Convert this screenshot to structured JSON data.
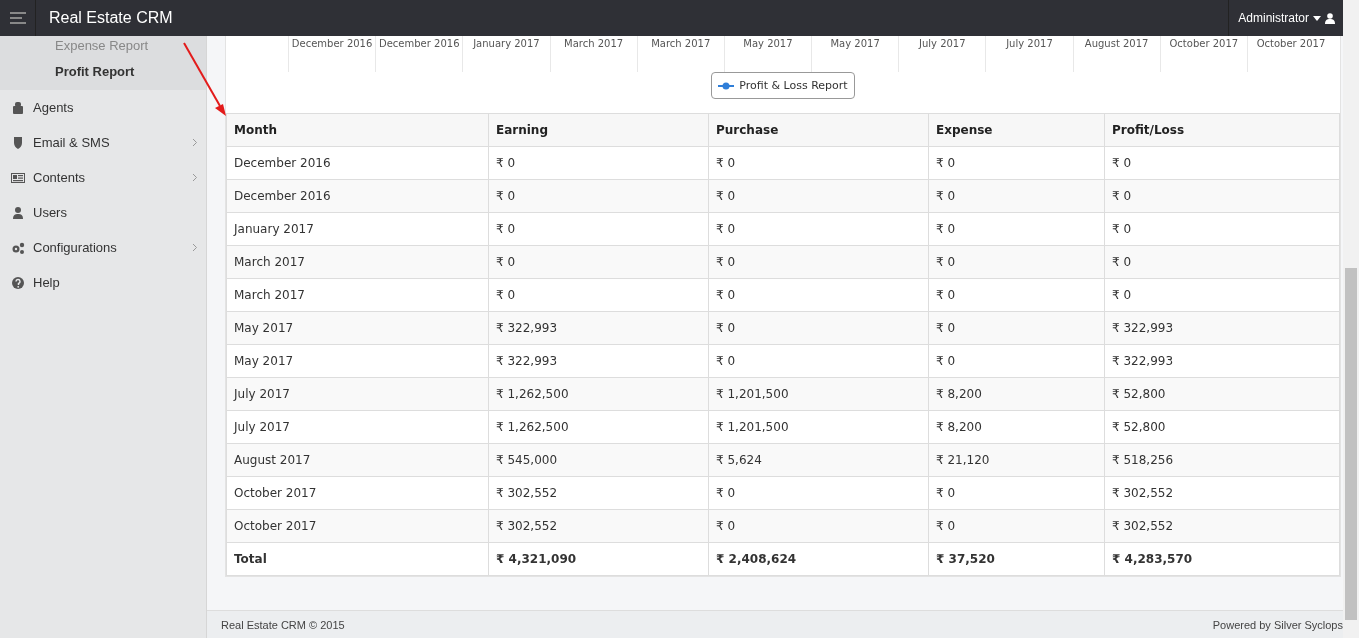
{
  "app": {
    "title": "Real Estate CRM",
    "user": "Administrator"
  },
  "sidebar": {
    "subitems": [
      {
        "label": "Expense Report",
        "selected": false
      },
      {
        "label": "Profit Report",
        "selected": true
      }
    ],
    "items": [
      {
        "label": "Agents",
        "has_children": false
      },
      {
        "label": "Email & SMS",
        "has_children": true
      },
      {
        "label": "Contents",
        "has_children": true
      },
      {
        "label": "Users",
        "has_children": false
      },
      {
        "label": "Configurations",
        "has_children": true
      },
      {
        "label": "Help",
        "has_children": false
      }
    ]
  },
  "chart": {
    "x_labels": [
      "December 2016",
      "December 2016",
      "January 2017",
      "March 2017",
      "March 2017",
      "May 2017",
      "May 2017",
      "July 2017",
      "July 2017",
      "August 2017",
      "October 2017",
      "October 2017"
    ],
    "legend": "Profit & Loss Report"
  },
  "table": {
    "columns": [
      "Month",
      "Earning",
      "Purchase",
      "Expense",
      "Profit/Loss"
    ],
    "rows": [
      [
        "December 2016",
        "₹ 0",
        "₹ 0",
        "₹ 0",
        "₹ 0"
      ],
      [
        "December 2016",
        "₹ 0",
        "₹ 0",
        "₹ 0",
        "₹ 0"
      ],
      [
        "January 2017",
        "₹ 0",
        "₹ 0",
        "₹ 0",
        "₹ 0"
      ],
      [
        "March 2017",
        "₹ 0",
        "₹ 0",
        "₹ 0",
        "₹ 0"
      ],
      [
        "March 2017",
        "₹ 0",
        "₹ 0",
        "₹ 0",
        "₹ 0"
      ],
      [
        "May 2017",
        "₹ 322,993",
        "₹ 0",
        "₹ 0",
        "₹ 322,993"
      ],
      [
        "May 2017",
        "₹ 322,993",
        "₹ 0",
        "₹ 0",
        "₹ 322,993"
      ],
      [
        "July 2017",
        "₹ 1,262,500",
        "₹ 1,201,500",
        "₹ 8,200",
        "₹ 52,800"
      ],
      [
        "July 2017",
        "₹ 1,262,500",
        "₹ 1,201,500",
        "₹ 8,200",
        "₹ 52,800"
      ],
      [
        "August 2017",
        "₹ 545,000",
        "₹ 5,624",
        "₹ 21,120",
        "₹ 518,256"
      ],
      [
        "October 2017",
        "₹ 302,552",
        "₹ 0",
        "₹ 0",
        "₹ 302,552"
      ],
      [
        "October 2017",
        "₹ 302,552",
        "₹ 0",
        "₹ 0",
        "₹ 302,552"
      ]
    ],
    "total": [
      "Total",
      "₹ 4,321,090",
      "₹ 2,408,624",
      "₹ 37,520",
      "₹ 4,283,570"
    ]
  },
  "footer": {
    "left": "Real Estate CRM © 2015",
    "right": "Powered by Silver Syclops"
  }
}
